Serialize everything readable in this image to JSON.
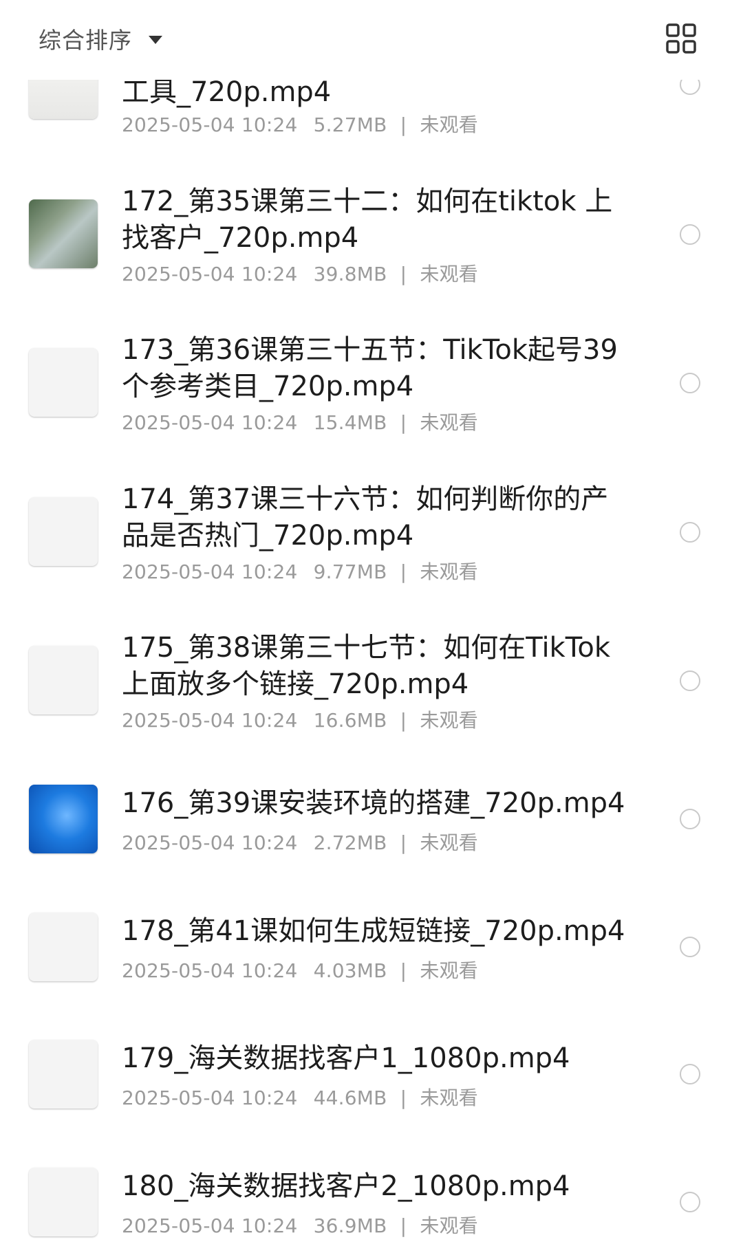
{
  "header": {
    "sort_label": "综合排序",
    "sort_icon": "caret-down-icon",
    "view_icon": "grid-view-icon"
  },
  "files": [
    {
      "title_lines": [
        "工具_720p.mp4"
      ],
      "date": "2025-05-04 10:24",
      "size": "5.27MB",
      "status": "未观看",
      "thumb": "th-white"
    },
    {
      "title_lines": [
        "172_第35课第三十二：如何在tiktok 上",
        "找客户_720p.mp4"
      ],
      "date": "2025-05-04 10:24",
      "size": "39.8MB",
      "status": "未观看",
      "thumb": "th-photo"
    },
    {
      "title_lines": [
        "173_第36课第三十五节：TikTok起号39",
        "个参考类目_720p.mp4"
      ],
      "date": "2025-05-04 10:24",
      "size": "15.4MB",
      "status": "未观看",
      "thumb": "th-doc"
    },
    {
      "title_lines": [
        "174_第37课三十六节：如何判断你的产",
        "品是否热门_720p.mp4"
      ],
      "date": "2025-05-04 10:24",
      "size": "9.77MB",
      "status": "未观看",
      "thumb": "th-doc"
    },
    {
      "title_lines": [
        "175_第38课第三十七节：如何在TikTok",
        "上面放多个链接_720p.mp4"
      ],
      "date": "2025-05-04 10:24",
      "size": "16.6MB",
      "status": "未观看",
      "thumb": "th-doc"
    },
    {
      "title_lines": [
        "176_第39课安装环境的搭建_720p.mp4"
      ],
      "date": "2025-05-04 10:24",
      "size": "2.72MB",
      "status": "未观看",
      "thumb": "th-blue"
    },
    {
      "title_lines": [
        "178_第41课如何生成短链接_720p.mp4"
      ],
      "date": "2025-05-04 10:24",
      "size": "4.03MB",
      "status": "未观看",
      "thumb": "th-doc"
    },
    {
      "title_lines": [
        "179_海关数据找客户1_1080p.mp4"
      ],
      "date": "2025-05-04 10:24",
      "size": "44.6MB",
      "status": "未观看",
      "thumb": "th-doc"
    },
    {
      "title_lines": [
        "180_海关数据找客户2_1080p.mp4"
      ],
      "date": "2025-05-04 10:24",
      "size": "36.9MB",
      "status": "未观看",
      "thumb": "th-doc"
    }
  ],
  "colors": {
    "title": "#1d1d1d",
    "meta": "#9a9a9a",
    "radio": "#c9c9c9"
  }
}
